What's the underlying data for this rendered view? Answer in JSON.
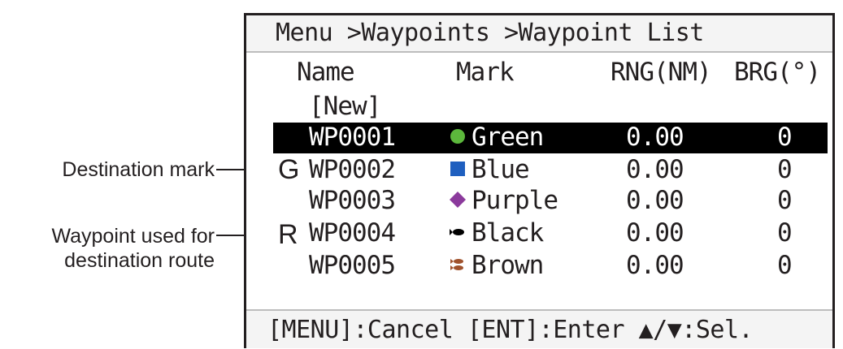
{
  "callouts": {
    "destination_mark": "Destination mark",
    "waypoint_used_line1": "Waypoint used for",
    "waypoint_used_line2": "destination route",
    "flag_g": "G",
    "flag_r": "R"
  },
  "screen": {
    "breadcrumb": "Menu >Waypoints >Waypoint List",
    "columns": {
      "name": "Name",
      "mark": "Mark",
      "rng": "RNG(NM)",
      "brg": "BRG(°)"
    },
    "new_item": "[New]",
    "rows": [
      {
        "name": "WP0001",
        "mark": "Green",
        "mark_icon": "green-circle-icon",
        "mark_color": "#5cb83c",
        "rng": "0.00",
        "brg": "0",
        "selected": true
      },
      {
        "name": "WP0002",
        "mark": "Blue",
        "mark_icon": "blue-square-icon",
        "mark_color": "#1f5fbf",
        "rng": "0.00",
        "brg": "0"
      },
      {
        "name": "WP0003",
        "mark": "Purple",
        "mark_icon": "purple-diamond-icon",
        "mark_color": "#8b3a9c",
        "rng": "0.00",
        "brg": "0"
      },
      {
        "name": "WP0004",
        "mark": "Black",
        "mark_icon": "black-fish-icon",
        "mark_color": "#000000",
        "rng": "0.00",
        "brg": "0"
      },
      {
        "name": "WP0005",
        "mark": "Brown",
        "mark_icon": "brown-fish-icon",
        "mark_color": "#a0522d",
        "rng": "0.00",
        "brg": "0"
      }
    ],
    "footer": "[MENU]:Cancel [ENT]:Enter ▲/▼:Sel."
  }
}
